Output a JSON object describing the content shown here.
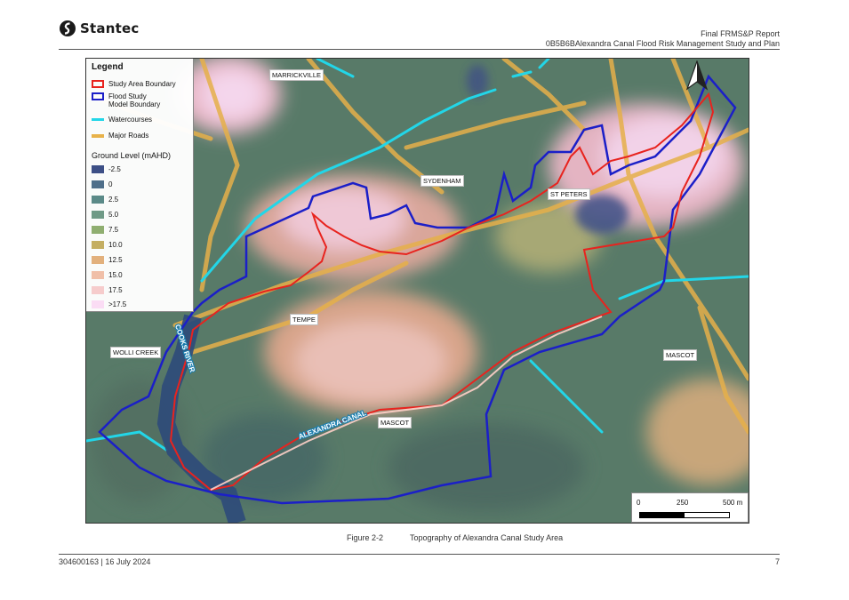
{
  "header": {
    "logo_text": "Stantec",
    "report_title": "Final FRMS&P Report",
    "report_subtitle": "0B5B6BAlexandra Canal Flood Risk Management Study and Plan"
  },
  "legend": {
    "title": "Legend",
    "items": [
      {
        "label": "Study Area Boundary",
        "color": "#e8231e",
        "kind": "box"
      },
      {
        "label": "Flood Study",
        "label2": "Model Boundary",
        "color": "#1b1fc8",
        "kind": "box"
      },
      {
        "label": "Watercourses",
        "color": "#22d6e8",
        "kind": "line"
      },
      {
        "label": "Major Roads",
        "color": "#e8b24a",
        "kind": "line"
      }
    ],
    "ground_title": "Ground Level (mAHD)",
    "ground_levels": [
      {
        "label": "-2.5",
        "color": "#3d4f86"
      },
      {
        "label": "0",
        "color": "#4f6f8a"
      },
      {
        "label": "2.5",
        "color": "#5b8a88"
      },
      {
        "label": "5.0",
        "color": "#6f9a86"
      },
      {
        "label": "7.5",
        "color": "#8fae70"
      },
      {
        "label": "10.0",
        "color": "#c4ae62"
      },
      {
        "label": "12.5",
        "color": "#e2b07c"
      },
      {
        "label": "15.0",
        "color": "#f0bfa8"
      },
      {
        "label": "17.5",
        "color": "#f6cccc"
      },
      {
        "label": ">17.5",
        "color": "#fadcf4"
      }
    ]
  },
  "places": {
    "marrickville": "MARRICKVILLE",
    "sydenham": "SYDENHAM",
    "st_peters": "ST PETERS",
    "tempe": "TEMPE",
    "wolli_creek": "WOLLI CREEK",
    "mascot_east": "MASCOT",
    "mascot_south": "MASCOT"
  },
  "waterway_labels": {
    "cooks_river": "COOKS RIVER",
    "alexandra_canal": "ALEXANDRA CANAL"
  },
  "scalebar": {
    "label_0": "0",
    "label_250": "250",
    "label_500": "500 m"
  },
  "figure": {
    "number": "Figure 2-2",
    "title": "Topography of Alexandra Canal Study Area"
  },
  "footer": {
    "doc_ref": "304600163 | 16 July 2024",
    "page_number": "7"
  }
}
